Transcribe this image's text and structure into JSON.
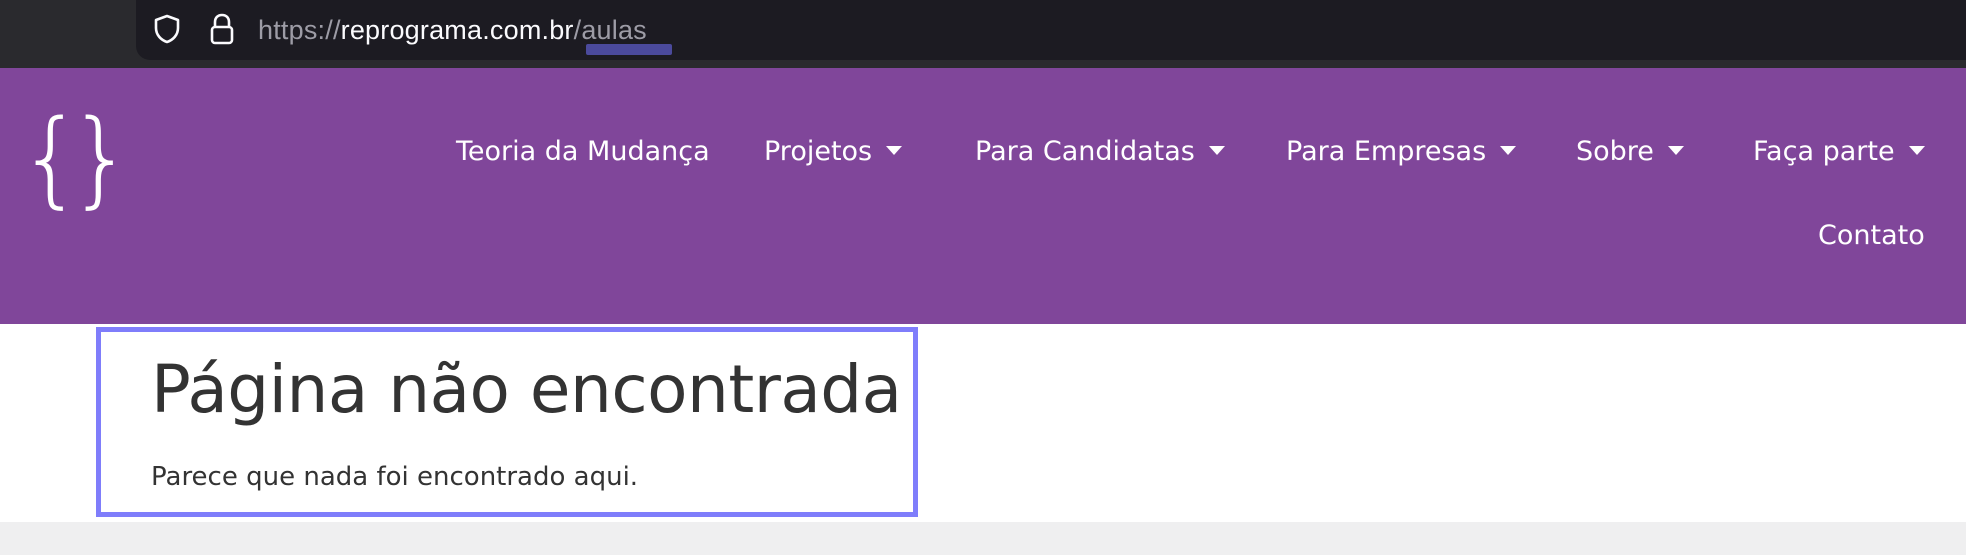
{
  "browser": {
    "url_protocol": "https://",
    "url_domain": "reprograma.com.br",
    "url_path": "/aulas",
    "icons": [
      "shield-icon",
      "lock-icon"
    ]
  },
  "header": {
    "logo": "{ }",
    "logo_left": "{",
    "logo_right": "}",
    "nav": [
      {
        "label": "Teoria da Mudança",
        "has_dropdown": false
      },
      {
        "label": "Projetos",
        "has_dropdown": true
      },
      {
        "label": "Para Candidatas",
        "has_dropdown": true
      },
      {
        "label": "Para Empresas",
        "has_dropdown": true
      },
      {
        "label": "Sobre",
        "has_dropdown": true
      },
      {
        "label": "Faça parte",
        "has_dropdown": true
      },
      {
        "label": "Contato",
        "has_dropdown": false
      }
    ]
  },
  "main": {
    "title": "Página não encontrada",
    "message": "Parece que nada foi encontrado aqui."
  },
  "colors": {
    "browser_bg": "#2a2a2e",
    "url_field_bg": "#1c1b22",
    "header_bg": "#80469a",
    "highlight_border": "#7f7dfb",
    "text_dark": "#333333",
    "footer_band": "#efeff0"
  }
}
